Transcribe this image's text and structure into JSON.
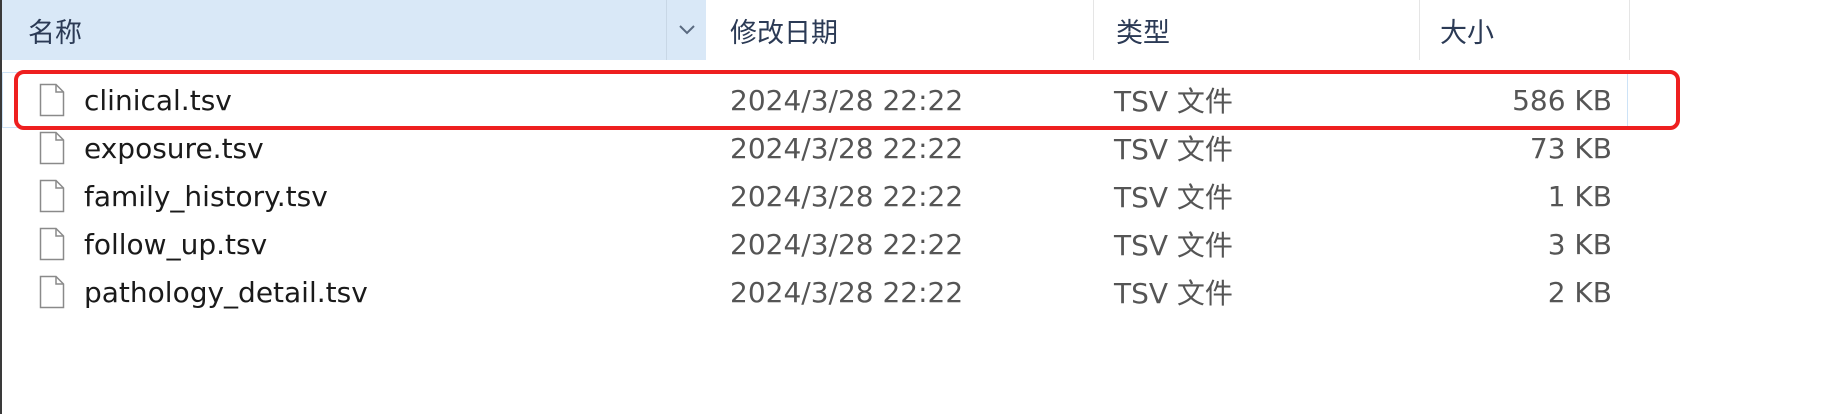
{
  "columns": {
    "name": "名称",
    "date": "修改日期",
    "type": "类型",
    "size": "大小"
  },
  "files": [
    {
      "name": "clinical.tsv",
      "date": "2024/3/28 22:22",
      "type": "TSV 文件",
      "size": "586 KB",
      "highlighted": true
    },
    {
      "name": "exposure.tsv",
      "date": "2024/3/28 22:22",
      "type": "TSV 文件",
      "size": "73 KB"
    },
    {
      "name": "family_history.tsv",
      "date": "2024/3/28 22:22",
      "type": "TSV 文件",
      "size": "1 KB"
    },
    {
      "name": "follow_up.tsv",
      "date": "2024/3/28 22:22",
      "type": "TSV 文件",
      "size": "3 KB"
    },
    {
      "name": "pathology_detail.tsv",
      "date": "2024/3/28 22:22",
      "type": "TSV 文件",
      "size": "2 KB"
    }
  ],
  "colors": {
    "header_active_bg": "#d9e8f7",
    "highlight_border": "#ee1f1f",
    "selection_outline": "#cde3f7"
  },
  "icons": {
    "sort": "chevron-down-icon",
    "file": "file-icon"
  }
}
